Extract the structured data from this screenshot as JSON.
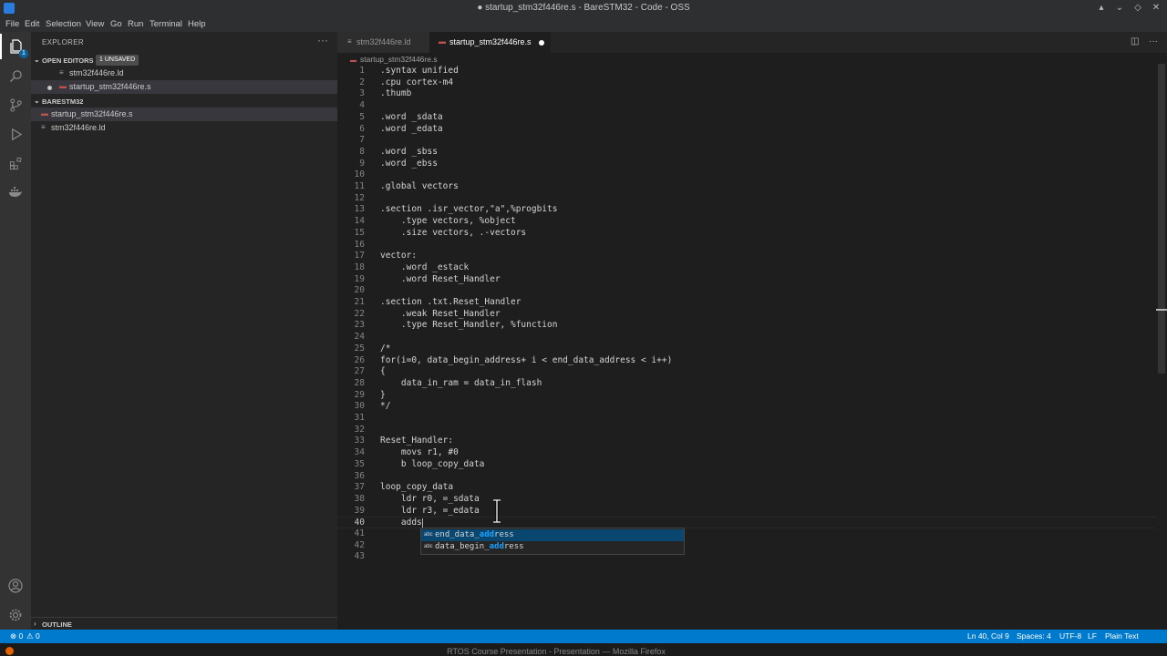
{
  "window": {
    "title": "● startup_stm32f446re.s - BareSTM32 - Code - OSS"
  },
  "menu": [
    "File",
    "Edit",
    "Selection",
    "View",
    "Go",
    "Run",
    "Terminal",
    "Help"
  ],
  "activity_bar": {
    "explorer_badge": "1",
    "icons": [
      "files-icon",
      "search-icon",
      "source-control-icon",
      "run-debug-icon",
      "extensions-icon",
      "docker-icon"
    ],
    "bottom_icons": [
      "account-icon",
      "settings-gear-icon"
    ]
  },
  "sidebar": {
    "title": "EXPLORER",
    "more": "···",
    "open_editors": {
      "label": "OPEN EDITORS",
      "badge": "1 UNSAVED",
      "files": [
        "stm32f446re.ld",
        "startup_stm32f446re.s"
      ]
    },
    "folder": {
      "label": "BARESTM32",
      "files": [
        "startup_stm32f446re.s",
        "stm32f446re.ld"
      ]
    },
    "outline_label": "OUTLINE"
  },
  "tabs": [
    {
      "label": "stm32f446re.ld",
      "icon": "≡"
    },
    {
      "label": "startup_stm32f446re.s",
      "icon": "▬"
    }
  ],
  "breadcrumb": "startup_stm32f446re.s",
  "code_lines": [
    ".syntax unified",
    ".cpu cortex-m4",
    ".thumb",
    "",
    ".word _sdata",
    ".word _edata",
    "",
    ".word _sbss",
    ".word _ebss",
    "",
    ".global vectors",
    "",
    ".section .isr_vector,\"a\",%progbits",
    "    .type vectors, %object",
    "    .size vectors, .-vectors",
    "",
    "vector:",
    "    .word _estack",
    "    .word Reset_Handler",
    "",
    ".section .txt.Reset_Handler",
    "    .weak Reset_Handler",
    "    .type Reset_Handler, %function",
    "",
    "/*",
    "for(i=0, data_begin_address+ i < end_data_address < i++)",
    "{",
    "    data_in_ram = data_in_flash",
    "}",
    "*/",
    "",
    "",
    "Reset_Handler:",
    "    movs r1, #0",
    "    b loop_copy_data",
    "",
    "loop_copy_data",
    "    ldr r0, =_sdata",
    "    ldr r3, =_edata",
    "    adds",
    "",
    "",
    ""
  ],
  "current_line": 40,
  "suggestions": [
    {
      "icon": "abc",
      "pre": "end_data_",
      "match": "add",
      "post": "ress"
    },
    {
      "icon": "abc",
      "pre": "data_begin_",
      "match": "add",
      "post": "ress"
    }
  ],
  "status": {
    "errors": "⊗ 0",
    "warnings": "⚠ 0",
    "position": "Ln 40, Col 9",
    "spaces": "Spaces: 4",
    "encoding": "UTF-8",
    "eol": "LF",
    "language": "Plain Text"
  },
  "taskbar": {
    "title": "RTOS Course Presentation - Presentation — Mozilla Firefox"
  }
}
